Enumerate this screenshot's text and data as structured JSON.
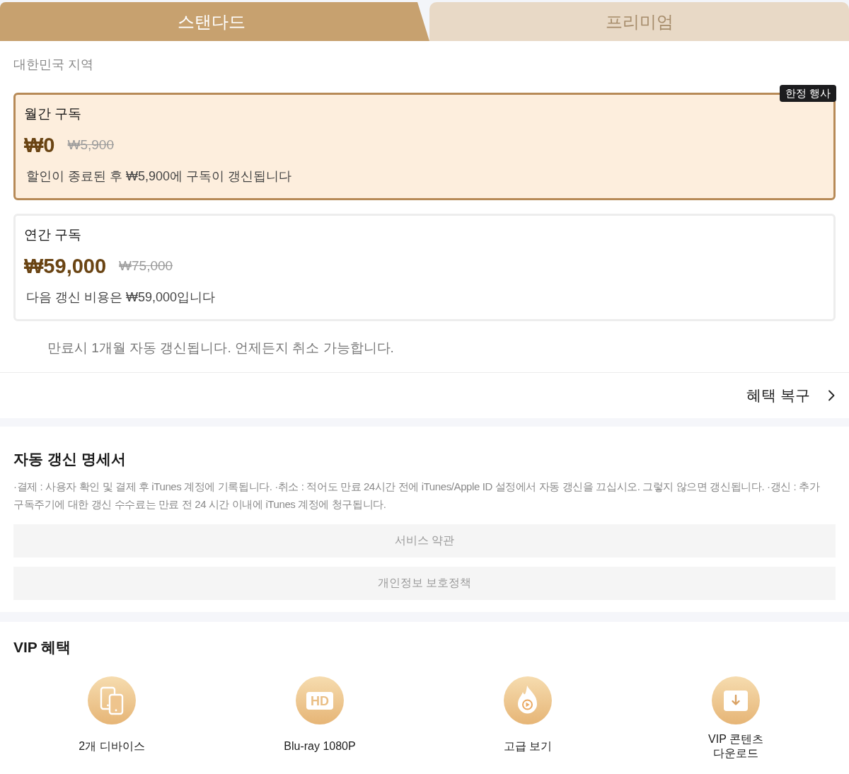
{
  "tabs": [
    {
      "label": "스탠다드",
      "selected": true
    },
    {
      "label": "프리미엄",
      "selected": false
    }
  ],
  "region": "대한민국 지역",
  "plans": [
    {
      "name": "월간 구독",
      "price": "₩0",
      "original_price": "₩5,900",
      "note": "할인이 종료된 후 ₩5,900에 구독이 갱신됩니다",
      "badge": "한정 행사",
      "selected": true
    },
    {
      "name": "연간 구독",
      "price": "₩59,000",
      "original_price": "₩75,000",
      "note": "다음 갱신 비용은 ₩59,000입니다",
      "selected": false
    }
  ],
  "renewal_note": "만료시 1개월 자동 갱신됩니다. 언제든지 취소 가능합니다.",
  "restore_link": {
    "label": "혜택 복구"
  },
  "auto_renewal": {
    "title": "자동 갱신 명세서",
    "text": "·결제 : 사용자 확인 및 결제 후 iTunes 계정에 기록됩니다. ·취소 : 적어도 만료 24시간 전에 iTunes/Apple ID 설정에서 자동 갱신을 끄십시오. 그렇지 않으면 갱신됩니다. ·갱신 : 추가 구독주기에 대한 갱신 수수료는 만료 전 24 시간 이내에 iTunes 계정에 청구됩니다.",
    "links": [
      "서비스 약관",
      "개인정보 보호정책"
    ]
  },
  "vip_benefits": {
    "title": "VIP 혜택",
    "items": [
      {
        "kind": "devices",
        "label": "2개 디바이스"
      },
      {
        "kind": "hd",
        "icon_label": "HD",
        "label": "Blu-ray 1080P"
      },
      {
        "kind": "flame",
        "label": "고급 보기"
      },
      {
        "kind": "download",
        "label": "VIP 콘텐츠\n다운로드"
      }
    ]
  }
}
